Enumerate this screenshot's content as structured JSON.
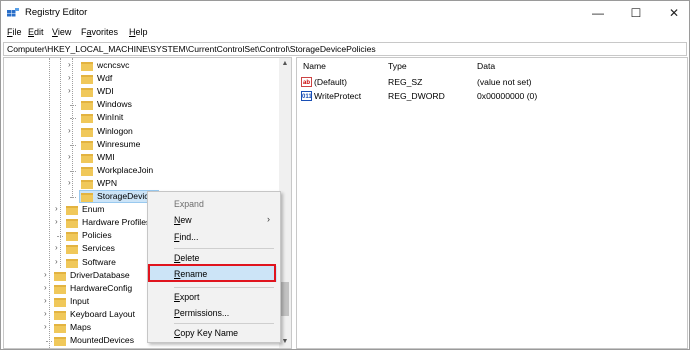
{
  "window": {
    "title": "Registry Editor",
    "controls": {
      "minimize": "—",
      "maximize": "☐",
      "close": "✕"
    }
  },
  "menu": [
    {
      "pre": "",
      "u": "F",
      "post": "ile"
    },
    {
      "pre": "",
      "u": "E",
      "post": "dit"
    },
    {
      "pre": "",
      "u": "V",
      "post": "iew"
    },
    {
      "pre": "F",
      "u": "a",
      "post": "vorites"
    },
    {
      "pre": "",
      "u": "H",
      "post": "elp"
    }
  ],
  "address": "Computer\\HKEY_LOCAL_MACHINE\\SYSTEM\\CurrentControlSet\\Control\\StorageDevicePolicies",
  "tree": {
    "items": [
      {
        "label": "wcncsvc",
        "expandable": true
      },
      {
        "label": "Wdf",
        "expandable": true
      },
      {
        "label": "WDI",
        "expandable": true
      },
      {
        "label": "Windows",
        "expandable": false
      },
      {
        "label": "WinInit",
        "expandable": false
      },
      {
        "label": "Winlogon",
        "expandable": true
      },
      {
        "label": "Winresume",
        "expandable": false
      },
      {
        "label": "WMI",
        "expandable": true
      },
      {
        "label": "WorkplaceJoin",
        "expandable": false
      },
      {
        "label": "WPN",
        "expandable": true
      },
      {
        "label": "StorageDevice",
        "expandable": false,
        "selected": true
      },
      {
        "label": "Enum",
        "expandable": true
      },
      {
        "label": "Hardware Profiles",
        "expandable": true
      },
      {
        "label": "Policies",
        "expandable": false
      },
      {
        "label": "Services",
        "expandable": true
      },
      {
        "label": "Software",
        "expandable": true
      },
      {
        "label": "DriverDatabase",
        "expandable": true
      },
      {
        "label": "HardwareConfig",
        "expandable": true
      },
      {
        "label": "Input",
        "expandable": true
      },
      {
        "label": "Keyboard Layout",
        "expandable": true
      },
      {
        "label": "Maps",
        "expandable": true
      },
      {
        "label": "MountedDevices",
        "expandable": false
      }
    ]
  },
  "list": {
    "headers": {
      "name": "Name",
      "type": "Type",
      "data": "Data"
    },
    "rows": [
      {
        "icon": "ab",
        "icon_name": "string-value-icon",
        "name": "(Default)",
        "type": "REG_SZ",
        "data": "(value not set)"
      },
      {
        "icon": "011",
        "icon_name": "dword-value-icon",
        "name": "WriteProtect",
        "type": "REG_DWORD",
        "data": "0x00000000 (0)"
      }
    ]
  },
  "context_menu": {
    "items": [
      {
        "id": "expand",
        "pre": "Expand",
        "u": "",
        "post": "",
        "dim": true
      },
      {
        "id": "new",
        "pre": "",
        "u": "N",
        "post": "ew",
        "submenu": "›"
      },
      {
        "id": "find",
        "pre": "",
        "u": "F",
        "post": "ind..."
      },
      {
        "id": "delete",
        "pre": "",
        "u": "D",
        "post": "elete"
      },
      {
        "id": "rename",
        "pre": "",
        "u": "R",
        "post": "ename",
        "highlighted": true
      },
      {
        "id": "export",
        "pre": "",
        "u": "E",
        "post": "xport"
      },
      {
        "id": "permissions",
        "pre": "",
        "u": "P",
        "post": "ermissions..."
      },
      {
        "id": "copy-key-name",
        "pre": "",
        "u": "C",
        "post": "opy Key Name"
      }
    ]
  },
  "colors": {
    "highlight_border": "#e0141e",
    "selection": "#cce4f7",
    "folder": "#f0c85a"
  }
}
